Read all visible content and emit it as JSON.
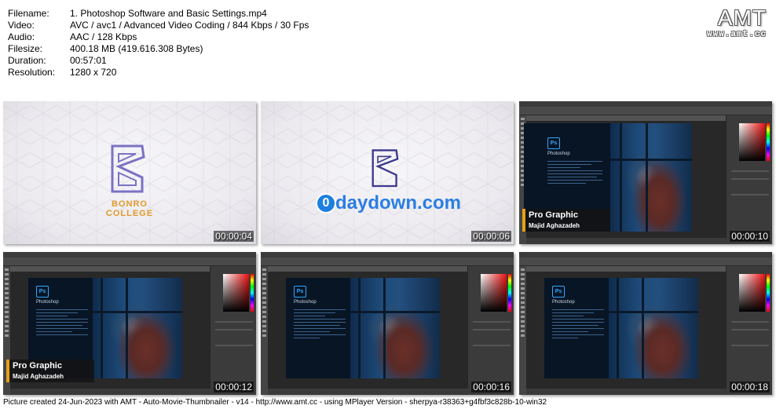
{
  "info": {
    "rows": [
      {
        "key": "Filename:",
        "value": "1. Photoshop Software and Basic Settings.mp4"
      },
      {
        "key": "Video:",
        "value": "AVC / avc1 / Advanced Video Coding / 844 Kbps / 30 Fps"
      },
      {
        "key": "Audio:",
        "value": "AAC / 128 Kbps"
      },
      {
        "key": "Filesize:",
        "value": "400.18 MB (419.616.308 Bytes)"
      },
      {
        "key": "Duration:",
        "value": "00:57:01"
      },
      {
        "key": "Resolution:",
        "value": "1280 x 720"
      }
    ]
  },
  "brand": {
    "logo": "AMT",
    "url": "www.amt.cc"
  },
  "thumbnails": [
    {
      "timestamp": "00:00:04",
      "kind": "intro",
      "logo_text_1": "BONRO",
      "logo_text_2": "COLLEGE"
    },
    {
      "timestamp": "00:00:06",
      "kind": "intro-watermark",
      "watermark": "daydown.com",
      "watermark_initial": "0"
    },
    {
      "timestamp": "00:00:10",
      "kind": "photoshop",
      "app_label": "Photoshop",
      "badge": "Ps",
      "overlay_title": "Pro Graphic",
      "overlay_name": "Majid Aghazadeh"
    },
    {
      "timestamp": "00:00:12",
      "kind": "photoshop",
      "app_label": "Photoshop",
      "badge": "Ps",
      "overlay_title": "Pro Graphic",
      "overlay_name": "Majid Aghazadeh"
    },
    {
      "timestamp": "00:00:16",
      "kind": "photoshop",
      "app_label": "Photoshop",
      "badge": "Ps"
    },
    {
      "timestamp": "00:00:18",
      "kind": "photoshop",
      "app_label": "Photoshop",
      "badge": "Ps"
    }
  ],
  "footer": "Picture created 24-Jun-2023 with AMT - Auto-Movie-Thumbnailer - v14 - http://www.amt.cc - using MPlayer Version - sherpya-r38363+g4fbf3c828b-10-win32",
  "colors": {
    "accent": "#e5a216",
    "ps_blue": "#31a8ff",
    "logo_purple": "#7b72c4",
    "watermark_blue": "#2a7ee3"
  }
}
